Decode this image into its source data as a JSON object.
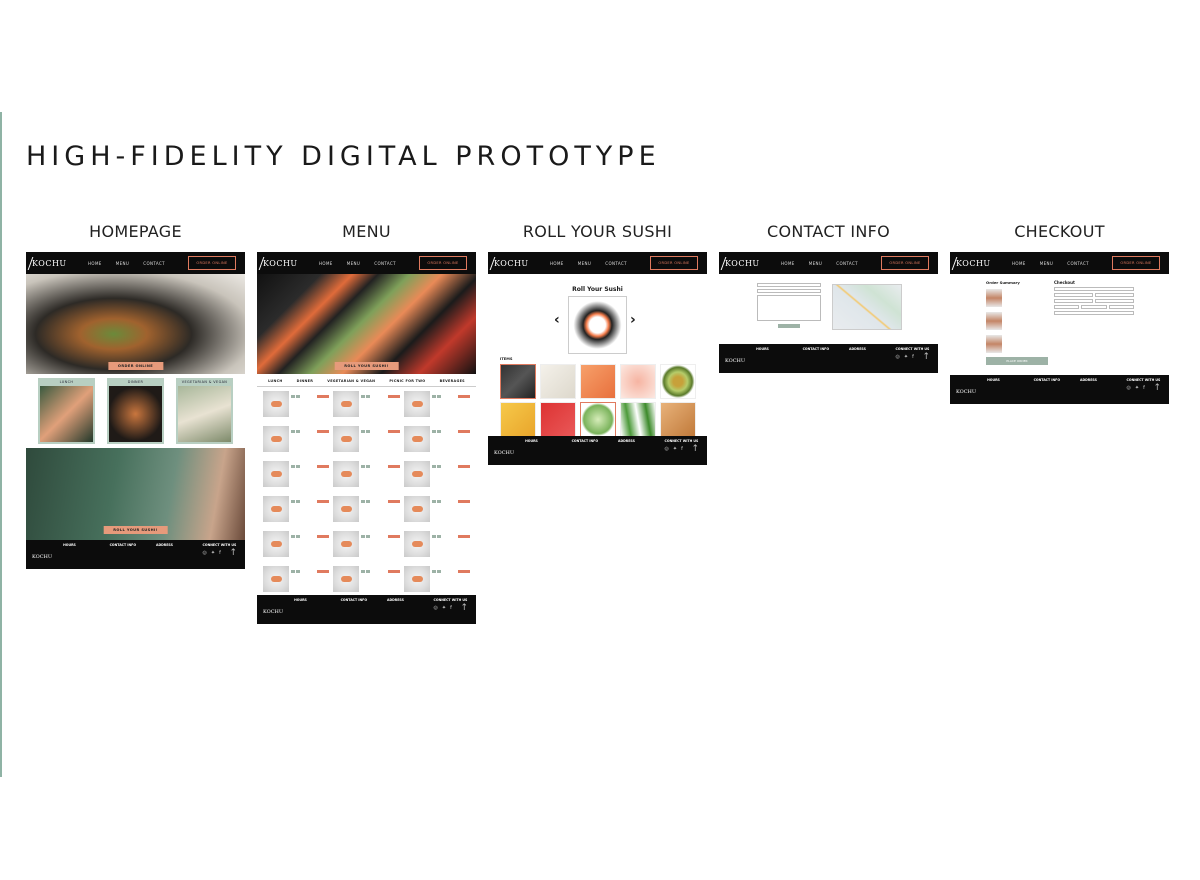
{
  "slide": {
    "title": "HIGH-FIDELITY DIGITAL PROTOTYPE"
  },
  "nav": {
    "logo": "KOCHU",
    "links": [
      "HOME",
      "MENU",
      "CONTACT"
    ],
    "order_button": "ORDER ONLINE"
  },
  "footer": {
    "logo": "KOCHU",
    "col1_title": "HOURS",
    "col2_title": "CONTACT INFO",
    "col3_title": "ADDRESS",
    "social_title": "CONNECT WITH US"
  },
  "frames": {
    "homepage": {
      "label": "HOMEPAGE",
      "hero_cta": "ORDER ONLINE",
      "categories": [
        "LUNCH",
        "DINNER",
        "VEGETARIAN & VEGAN"
      ],
      "roll_cta": "ROLL YOUR SUSHI!"
    },
    "menu": {
      "label": "MENU",
      "hero_cta": "ROLL YOUR SUSHI!",
      "tabs": [
        "LUNCH",
        "DINNER",
        "VEGETARIAN & VEGAN",
        "PICNIC FOR TWO",
        "BEVERAGES"
      ]
    },
    "roll": {
      "label": "ROLL YOUR SUSHI",
      "heading": "Roll Your Sushi",
      "ingredients_label": "ITEMS"
    },
    "contact": {
      "label": "CONTACT INFO"
    },
    "checkout": {
      "label": "CHECKOUT",
      "summary_title": "Order Summary",
      "form_title": "Checkout",
      "place_order": "PLACE ORDER"
    }
  }
}
